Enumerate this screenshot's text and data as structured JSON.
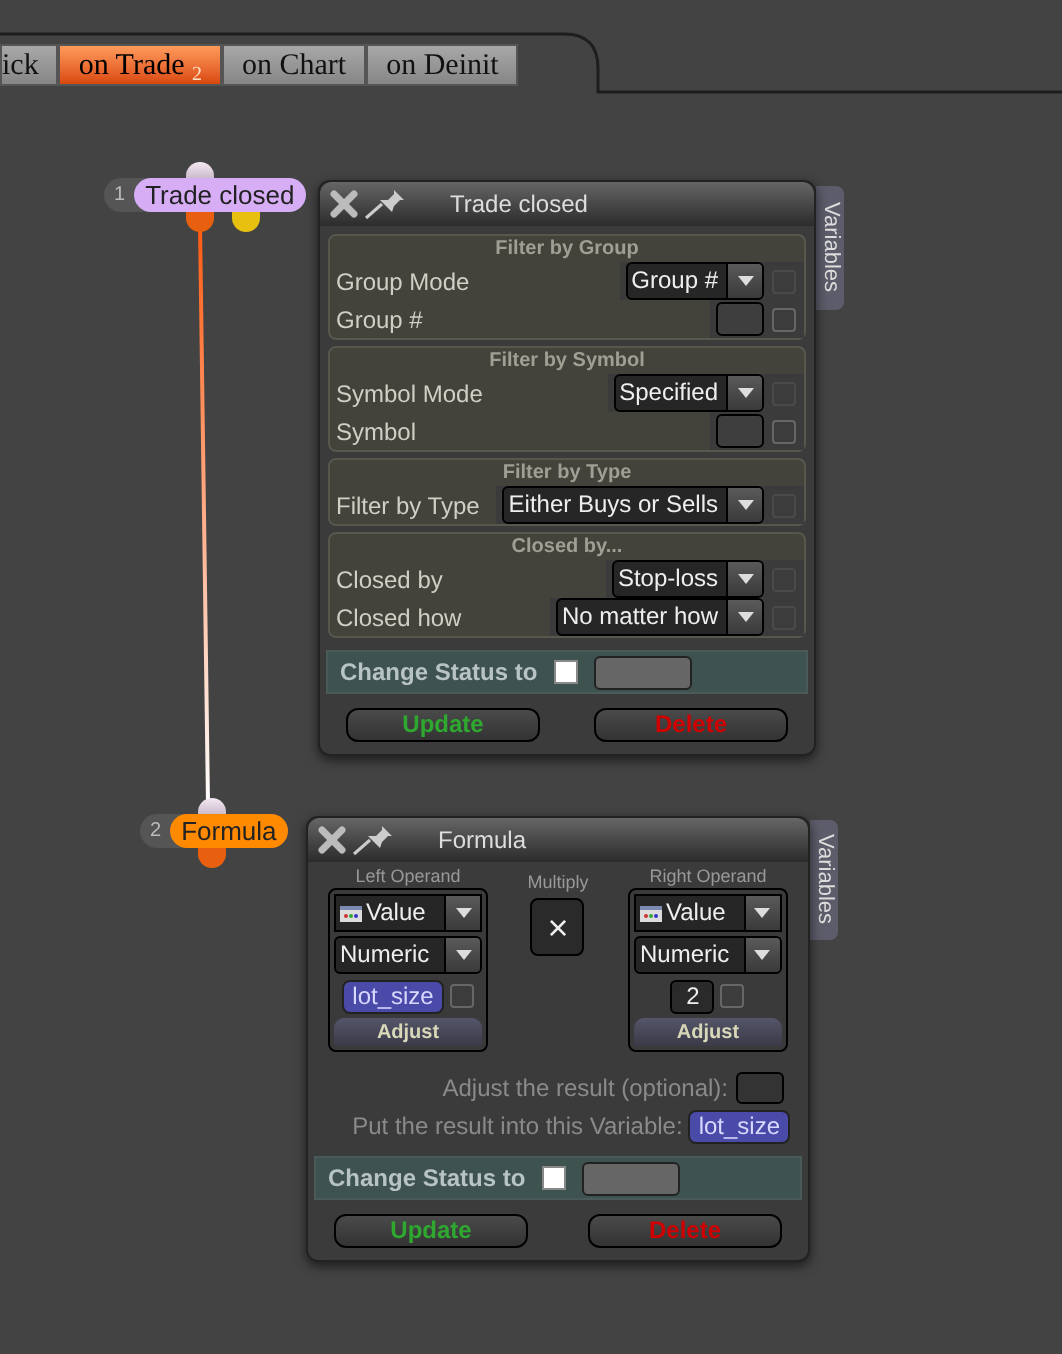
{
  "tabs": [
    {
      "label": "ick",
      "selected": false
    },
    {
      "label": "on Trade $_{2}$",
      "selected": true
    },
    {
      "label": "on Chart",
      "selected": false
    },
    {
      "label": "on Deinit",
      "selected": false
    }
  ],
  "nodes": [
    {
      "kind": "filter",
      "number": "1",
      "label": "Trade closed",
      "color": "#d7aef5",
      "ports": [
        {
          "color": "#e8600f"
        },
        {
          "color": "#e8c010"
        }
      ],
      "title": "Trade closed",
      "side_tab": "Variables",
      "sections": [
        {
          "title": "Filter by Group",
          "rows": [
            {
              "label": "Group Mode",
              "control": {
                "kind": "select",
                "value": "Group #"
              },
              "checked": false
            },
            {
              "label": "Group #",
              "control": {
                "kind": "field"
              },
              "checked": false
            }
          ]
        },
        {
          "title": "Filter by Symbol",
          "rows": [
            {
              "label": "Symbol Mode",
              "control": {
                "kind": "select",
                "value": "Specified"
              },
              "checked": false
            },
            {
              "label": "Symbol",
              "control": {
                "kind": "field"
              },
              "checked": false
            }
          ]
        },
        {
          "title": "Filter by Type",
          "rows": [
            {
              "label": "Filter by Type",
              "control": {
                "kind": "select",
                "value": "Either Buys or Sells"
              },
              "checked": false
            }
          ]
        },
        {
          "title": "Closed by...",
          "rows": [
            {
              "label": "Closed by",
              "control": {
                "kind": "select",
                "value": "Stop-loss"
              },
              "checked": false
            },
            {
              "label": "Closed how",
              "control": {
                "kind": "select",
                "value": "No matter how"
              },
              "checked": false
            }
          ]
        }
      ],
      "status": {
        "label": "Change Status to",
        "checked": false
      },
      "buttons": [
        {
          "label": "Update",
          "kind": "update"
        },
        {
          "label": "Delete",
          "kind": "delete"
        }
      ]
    },
    {
      "kind": "formula",
      "number": "2",
      "label": "Formula",
      "color": "#ff8a00",
      "ports": [
        {
          "color": "#e8600f"
        }
      ],
      "title": "Formula",
      "side_tab": "Variables",
      "operands": [
        {
          "label": "Left Operand",
          "type": "Value",
          "format": "Numeric",
          "value": {
            "kind": "variable",
            "text": "lot_size",
            "checked": false
          },
          "button": "Adjust"
        },
        {
          "label": "Right Operand",
          "type": "Value",
          "format": "Numeric",
          "value": {
            "kind": "number",
            "text": "2",
            "checked": false
          },
          "button": "Adjust"
        }
      ],
      "operator": {
        "label": "Multiply",
        "symbol": "×"
      },
      "adjust_label": "Adjust the result (optional):",
      "result_label": "Put the result into this Variable:",
      "result_variable": "lot_size",
      "status": {
        "label": "Change Status to",
        "checked": false
      },
      "buttons": [
        {
          "label": "Update",
          "kind": "update"
        },
        {
          "label": "Delete",
          "kind": "delete"
        }
      ]
    }
  ]
}
